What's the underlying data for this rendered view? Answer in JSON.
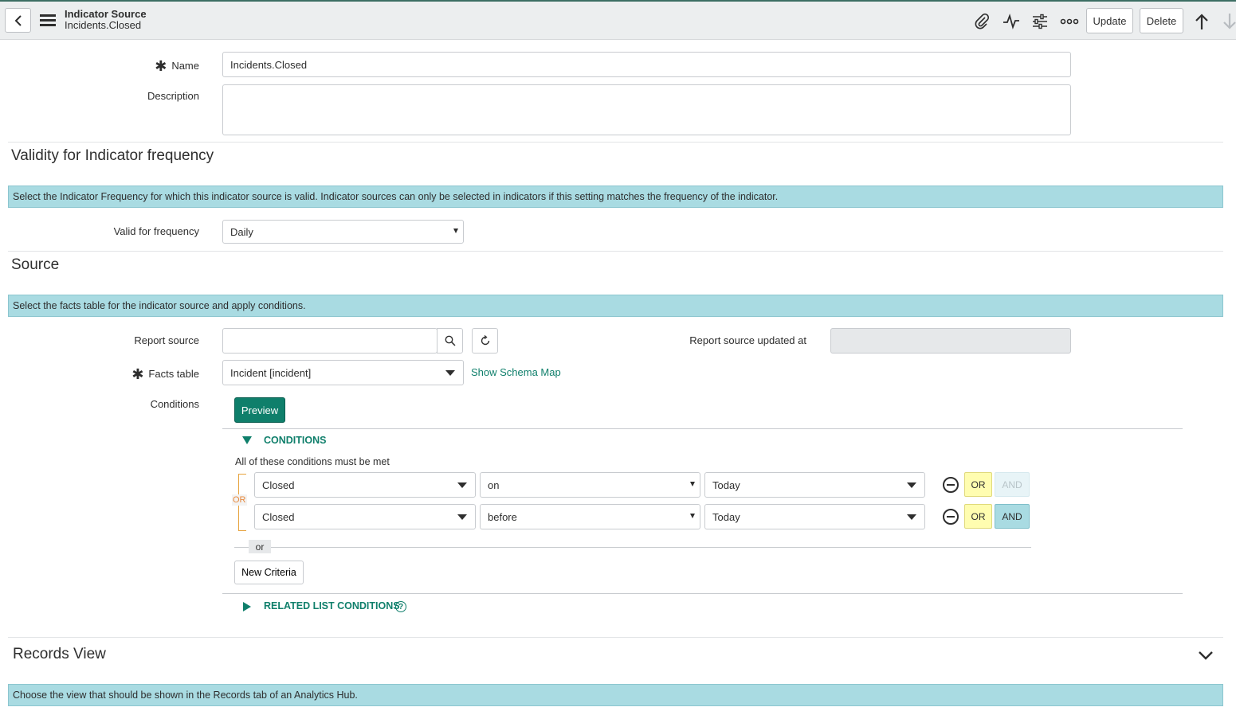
{
  "header": {
    "title": "Indicator Source",
    "subtitle": "Incidents.Closed",
    "update_label": "Update",
    "delete_label": "Delete"
  },
  "form": {
    "name_label": "Name",
    "name_value": "Incidents.Closed",
    "description_label": "Description",
    "description_value": ""
  },
  "validity": {
    "title": "Validity for Indicator frequency",
    "info": "Select the Indicator Frequency for which this indicator source is valid. Indicator sources can only be selected in indicators if this setting matches the frequency of the indicator.",
    "frequency_label": "Valid for frequency",
    "frequency_value": "Daily"
  },
  "source": {
    "title": "Source",
    "info": "Select the facts table for the indicator source and apply conditions.",
    "report_source_label": "Report source",
    "report_source_value": "",
    "report_updated_label": "Report source updated at",
    "report_updated_value": "",
    "facts_table_label": "Facts table",
    "facts_table_value": "Incident [incident]",
    "schema_link": "Show Schema Map",
    "conditions_label": "Conditions",
    "preview_label": "Preview"
  },
  "conditions": {
    "header": "CONDITIONS",
    "must_be_met": "All of these conditions must be met",
    "or_tag": "OR",
    "rows": [
      {
        "field": "Closed",
        "operator": "on",
        "value": "Today",
        "or": "OR",
        "and": "AND"
      },
      {
        "field": "Closed",
        "operator": "before",
        "value": "Today",
        "or": "OR",
        "and": "AND"
      }
    ],
    "or_separator": "or",
    "new_criteria_label": "New Criteria",
    "related_header": "RELATED LIST CONDITIONS",
    "help_glyph": "?"
  },
  "records_view": {
    "title": "Records View",
    "info": "Choose the view that should be shown in the Records tab of an Analytics Hub."
  }
}
